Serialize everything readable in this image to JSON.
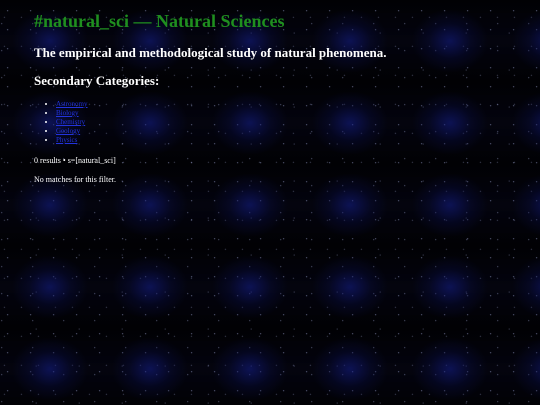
{
  "page": {
    "title": "#natural_sci — Natural Sciences",
    "description": "The empirical and methodological study of natural phenomena.",
    "secondary_heading": "Secondary Categories:"
  },
  "categories": [
    {
      "label": "Astronomy"
    },
    {
      "label": "Biology"
    },
    {
      "label": "Chemistry"
    },
    {
      "label": "Geology"
    },
    {
      "label": "Physics"
    }
  ],
  "results": {
    "summary": "0 results • s=[natural_sci]",
    "empty_message": "No matches for this filter."
  },
  "colors": {
    "title": "#1f8f1f",
    "link": "#2233dd",
    "text": "#ffffff",
    "background": "#020208"
  }
}
